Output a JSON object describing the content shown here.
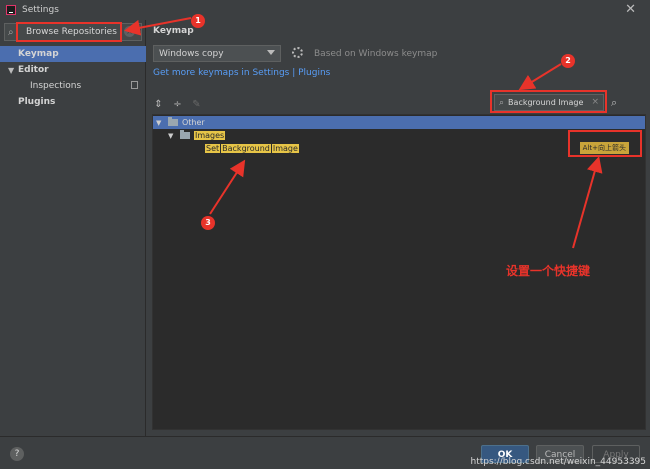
{
  "window": {
    "title": "Settings",
    "close": "✕"
  },
  "sidebar": {
    "search_value": "Browse Repositories",
    "items": [
      {
        "label": "Keymap",
        "level": 0,
        "selected": true,
        "arrow": ""
      },
      {
        "label": "Editor",
        "level": 0,
        "selected": false,
        "arrow": "▼"
      },
      {
        "label": "Inspections",
        "level": 1,
        "selected": false,
        "arrow": ""
      },
      {
        "label": "Plugins",
        "level": 0,
        "selected": false,
        "arrow": ""
      }
    ]
  },
  "main": {
    "title": "Keymap",
    "keymap_select": "Windows copy",
    "based_on": "Based on Windows keymap",
    "link": "Get more keymaps in Settings | Plugins",
    "filter_value": "Background Image",
    "tree": {
      "root": "Other",
      "folder": "Images",
      "action_words": [
        "Set",
        "Background",
        "Image"
      ],
      "shortcut": "Alt+向上箭头"
    }
  },
  "annotations": {
    "n1": "1",
    "n2": "2",
    "n3": "3",
    "caption": "设置一个快捷键"
  },
  "buttons": {
    "ok": "OK",
    "cancel": "Cancel",
    "apply": "Apply",
    "help": "?"
  },
  "watermark": "https://blog.csdn.net/weixin_44953395",
  "colors": {
    "accent": "#4b6eaf",
    "annotation": "#e8332a",
    "highlight": "#e7c547",
    "link": "#589df6"
  }
}
